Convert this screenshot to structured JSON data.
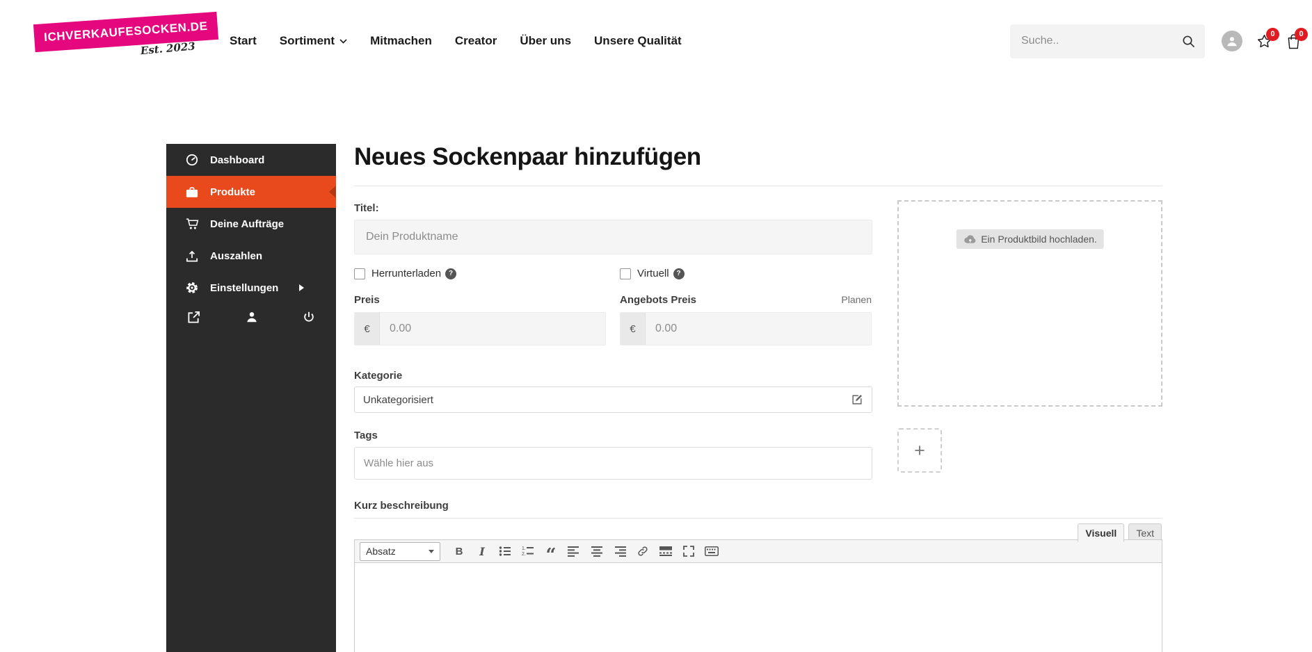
{
  "header": {
    "logo": {
      "main": "ICHVERKAUFESOCKEN.DE",
      "sub": "Est. 2023"
    },
    "nav": [
      {
        "label": "Start"
      },
      {
        "label": "Sortiment"
      },
      {
        "label": "Mitmachen"
      },
      {
        "label": "Creator"
      },
      {
        "label": "Über uns"
      },
      {
        "label": "Unsere Qualität"
      }
    ],
    "search": {
      "placeholder": "Suche.."
    },
    "wishlist_count": "0",
    "cart_count": "0",
    "colors": {
      "logo_pink": "#e5077e",
      "badge_red": "#e11b22"
    }
  },
  "sidebar": {
    "items": [
      {
        "label": "Dashboard",
        "icon": "dashboard-icon",
        "active": false
      },
      {
        "label": "Produkte",
        "icon": "briefcase-icon",
        "active": true
      },
      {
        "label": "Deine Aufträge",
        "icon": "cart-icon",
        "active": false
      },
      {
        "label": "Auszahlen",
        "icon": "upload-icon",
        "active": false
      },
      {
        "label": "Einstellungen",
        "icon": "gear-icon",
        "active": false,
        "has_submenu": true
      }
    ],
    "footer_icons": [
      "external-link-icon",
      "user-icon",
      "power-icon"
    ],
    "colors": {
      "background": "#2b2b2b",
      "active_background": "#e8491d"
    }
  },
  "main": {
    "title": "Neues Sockenpaar hinzufügen",
    "form": {
      "help_glyph": "?",
      "title_field": {
        "label": "Titel:",
        "placeholder": "Dein Produktname"
      },
      "checkboxes": [
        {
          "label": "Herrunterladen",
          "checked": false
        },
        {
          "label": "Virtuell",
          "checked": false
        }
      ],
      "price": {
        "label": "Preis",
        "currency": "€",
        "placeholder": "0.00"
      },
      "sale_price": {
        "label": "Angebots Preis",
        "currency": "€",
        "placeholder": "0.00",
        "action_label": "Planen"
      },
      "category": {
        "label": "Kategorie",
        "value": "Unkategorisiert"
      },
      "tags": {
        "label": "Tags",
        "placeholder": "Wähle hier aus"
      },
      "short_description": {
        "label": "Kurz beschreibung"
      },
      "editor": {
        "tabs": [
          {
            "label": "Visuell"
          },
          {
            "label": "Text"
          }
        ],
        "paragraph_select": "Absatz",
        "glyphs": {
          "bold": "B",
          "italic": "I",
          "blockquote": "“"
        },
        "toolbar_icons": [
          "bold-icon",
          "italic-icon",
          "bullet-list-icon",
          "numbered-list-icon",
          "blockquote-icon",
          "align-left-icon",
          "align-center-icon",
          "align-right-icon",
          "link-icon",
          "more-tag-icon",
          "fullscreen-icon",
          "keyboard-icon"
        ]
      }
    },
    "upload": {
      "label": "Ein Produktbild hochladen.",
      "add_more_label": "+"
    }
  }
}
